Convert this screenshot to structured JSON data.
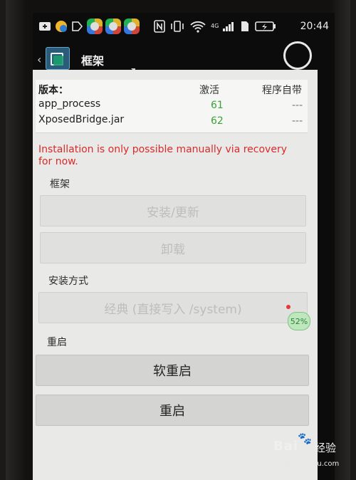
{
  "status_bar": {
    "time": "20:44",
    "network": "4G",
    "icons": [
      "plus-icon",
      "app-tile-icon",
      "nfc-icon",
      "vibrate-icon",
      "wifi-icon",
      "signal-icon",
      "sim-icon",
      "battery-icon"
    ]
  },
  "action_bar": {
    "title": "框架"
  },
  "version": {
    "label": "版本：",
    "col_active": "激活",
    "col_installed": "程序自带",
    "rows": [
      {
        "name": "app_process",
        "active": "61",
        "installed": "---"
      },
      {
        "name": "XposedBridge.jar",
        "active": "62",
        "installed": "---"
      }
    ]
  },
  "warning": "Installation is only possible manually via recovery for now.",
  "framework": {
    "section": "框架",
    "install_update": "安装/更新",
    "uninstall": "卸载"
  },
  "install_method": {
    "section": "安装方式",
    "value": "经典 (直接写入 /system)",
    "badge": "52%"
  },
  "reboot": {
    "section": "重启",
    "soft_reboot": "软重启",
    "reboot": "重启"
  },
  "watermark": {
    "logo": "Bai",
    "logo_suffix": "经验",
    "url": "jingyan.baidu.com"
  },
  "colors": {
    "accent_green": "#3ca13c",
    "warning_red": "#d92b2b",
    "content_bg": "#e9e9e7"
  }
}
